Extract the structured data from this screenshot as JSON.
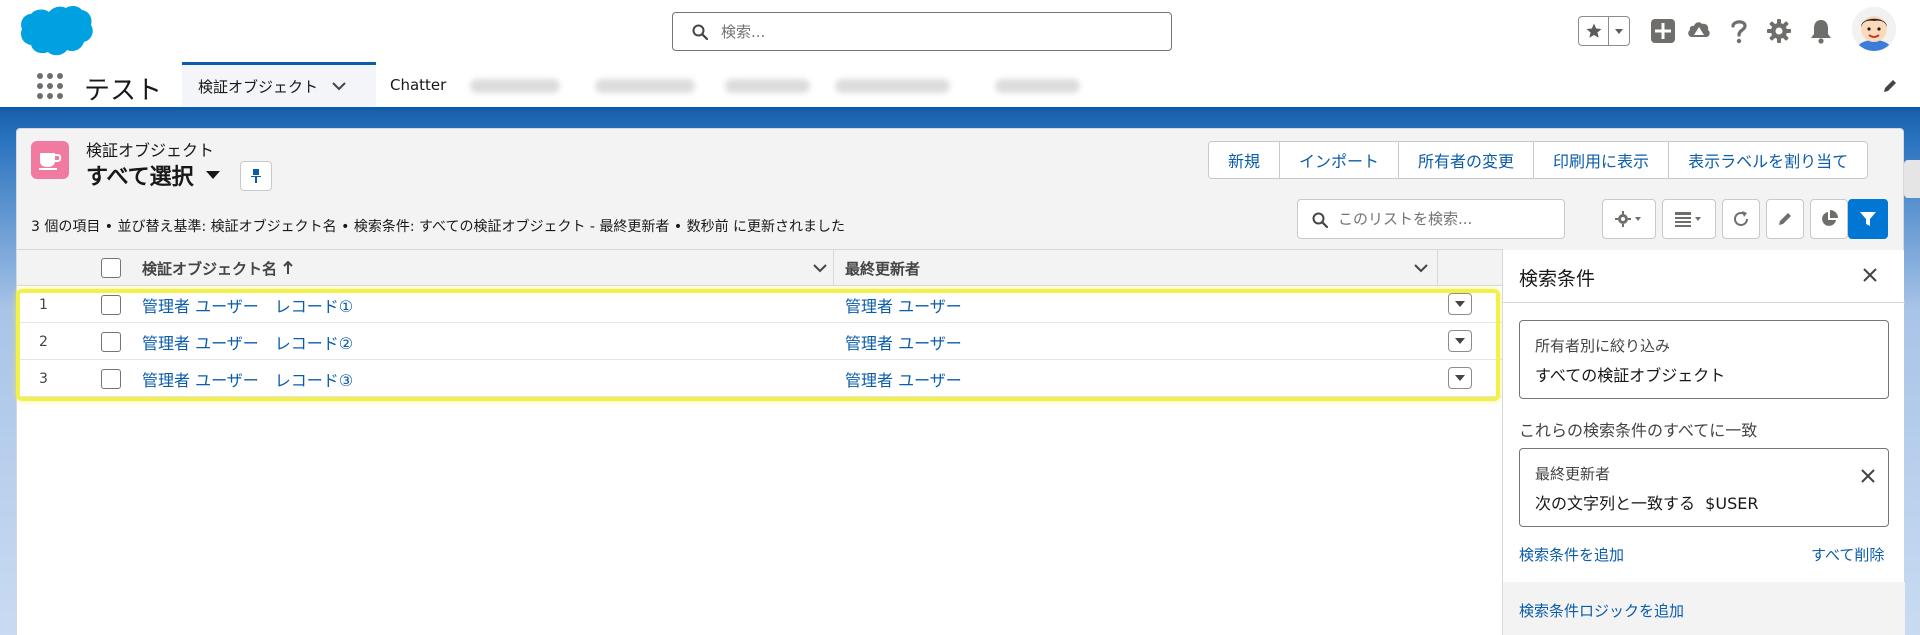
{
  "header": {
    "search_placeholder": "検索..."
  },
  "nav": {
    "app_name": "テスト",
    "active_tab": "検証オブジェクト",
    "tab_chatter": "Chatter"
  },
  "list": {
    "object_label": "検証オブジェクト",
    "view_name": "すべて選択",
    "actions": [
      "新規",
      "インポート",
      "所有者の変更",
      "印刷用に表示",
      "表示ラベルを割り当て"
    ],
    "summary": "3 個の項目 • 並び替え基準: 検証オブジェクト名 • 検索条件: すべての検証オブジェクト - 最終更新者 • 数秒前 に更新されました",
    "search_placeholder": "このリストを検索..."
  },
  "table": {
    "columns": [
      "検証オブジェクト名",
      "最終更新者"
    ],
    "rows": [
      {
        "num": "1",
        "name": "管理者 ユーザー　レコード①",
        "user": "管理者 ユーザー"
      },
      {
        "num": "2",
        "name": "管理者 ユーザー　レコード②",
        "user": "管理者 ユーザー"
      },
      {
        "num": "3",
        "name": "管理者 ユーザー　レコード③",
        "user": "管理者 ユーザー"
      }
    ]
  },
  "filters": {
    "title": "検索条件",
    "owner_label": "所有者別に絞り込み",
    "owner_value": "すべての検証オブジェクト",
    "match_label": "これらの検索条件のすべてに一致",
    "condition_label": "最終更新者",
    "condition_value": "次の文字列と一致する  $USER",
    "add_filter": "検索条件を追加",
    "remove_all": "すべて削除",
    "add_logic": "検索条件ロジックを追加"
  },
  "colors": {
    "brand_blue": "#0b5cab",
    "object_icon_pink": "#f07aa0",
    "highlight_yellow": "#f3f04a"
  }
}
